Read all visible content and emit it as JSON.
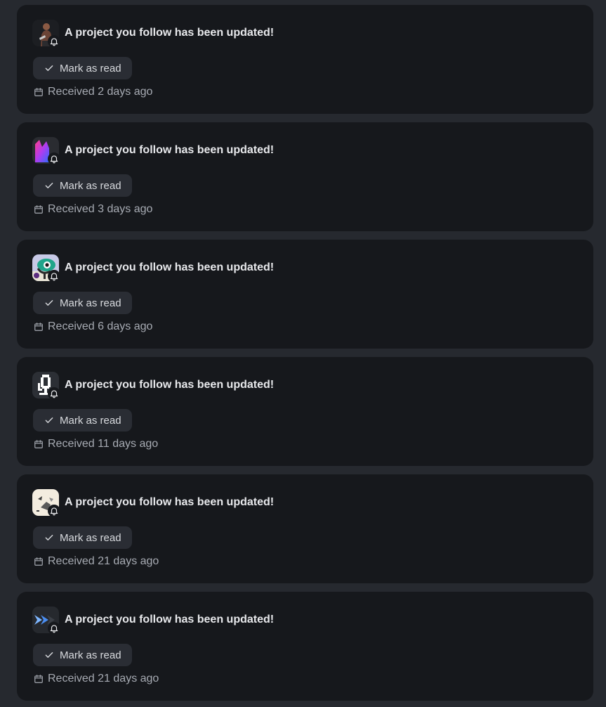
{
  "notifications": [
    {
      "title": "A project you follow has been updated!",
      "action_label": "Mark as read",
      "received": "Received 2 days ago",
      "avatar": "person-silhouette-avatar"
    },
    {
      "title": "A project you follow has been updated!",
      "action_label": "Mark as read",
      "received": "Received 3 days ago",
      "avatar": "gradient-crown-avatar"
    },
    {
      "title": "A project you follow has been updated!",
      "action_label": "Mark as read",
      "received": "Received 6 days ago",
      "avatar": "teal-creature-avatar"
    },
    {
      "title": "A project you follow has been updated!",
      "action_label": "Mark as read",
      "received": "Received 11 days ago",
      "avatar": "pixel-microphone-avatar"
    },
    {
      "title": "A project you follow has been updated!",
      "action_label": "Mark as read",
      "received": "Received 21 days ago",
      "avatar": "cream-sketch-avatar"
    },
    {
      "title": "A project you follow has been updated!",
      "action_label": "Mark as read",
      "received": "Received 21 days ago",
      "avatar": "chevron-arrows-avatar"
    }
  ],
  "colors": {
    "page_background": "#26292f",
    "card_background": "#16181c",
    "button_background": "#2a2d34",
    "title_text": "#e8e9ec",
    "muted_text": "#a7abb3"
  }
}
